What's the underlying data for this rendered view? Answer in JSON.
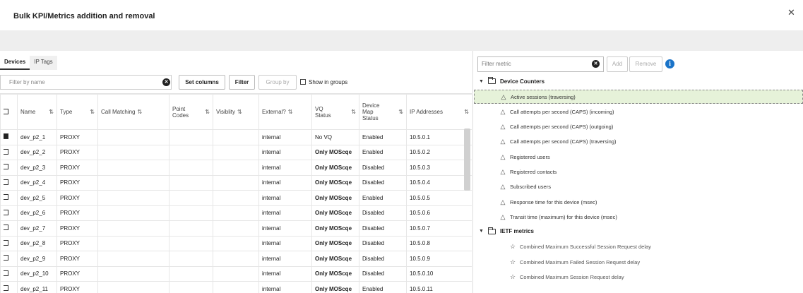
{
  "dialog": {
    "title": "Bulk KPI/Metrics addition and removal",
    "close_icon": "close-icon"
  },
  "tabs": [
    {
      "label": "Devices",
      "active": true
    },
    {
      "label": "IP Tags",
      "active": false
    }
  ],
  "toolbar": {
    "filter_placeholder": "Filter by name",
    "set_columns_label": "Set columns",
    "filter_label": "Filter",
    "group_by_label": "Group by",
    "show_in_groups_label": "Show in groups"
  },
  "table": {
    "headers": {
      "name": "Name",
      "type": "Type",
      "call_matching": "Call Matching",
      "point_codes": "Point Codes",
      "visibility": "Visiblity",
      "external": "External?",
      "vq_status": "VQ Status",
      "device_map_status": "Device Map Status",
      "ip_addresses": "IP Addresses"
    },
    "rows": [
      {
        "checked": true,
        "name": "dev_p2_1",
        "type": "PROXY",
        "external": "internal",
        "vq_status": "No VQ",
        "vq_bold": false,
        "map_status": "Enabled",
        "ip": "10.5.0.1"
      },
      {
        "checked": false,
        "name": "dev_p2_2",
        "type": "PROXY",
        "external": "internal",
        "vq_status": "Only MOScqe",
        "vq_bold": true,
        "map_status": "Enabled",
        "ip": "10.5.0.2"
      },
      {
        "checked": false,
        "name": "dev_p2_3",
        "type": "PROXY",
        "external": "internal",
        "vq_status": "Only MOScqe",
        "vq_bold": true,
        "map_status": "Disabled",
        "ip": "10.5.0.3"
      },
      {
        "checked": false,
        "name": "dev_p2_4",
        "type": "PROXY",
        "external": "internal",
        "vq_status": "Only MOScqe",
        "vq_bold": true,
        "map_status": "Disabled",
        "ip": "10.5.0.4"
      },
      {
        "checked": false,
        "name": "dev_p2_5",
        "type": "PROXY",
        "external": "internal",
        "vq_status": "Only MOScqe",
        "vq_bold": true,
        "map_status": "Enabled",
        "ip": "10.5.0.5"
      },
      {
        "checked": false,
        "name": "dev_p2_6",
        "type": "PROXY",
        "external": "internal",
        "vq_status": "Only MOScqe",
        "vq_bold": true,
        "map_status": "Disabled",
        "ip": "10.5.0.6"
      },
      {
        "checked": false,
        "name": "dev_p2_7",
        "type": "PROXY",
        "external": "internal",
        "vq_status": "Only MOScqe",
        "vq_bold": true,
        "map_status": "Disabled",
        "ip": "10.5.0.7"
      },
      {
        "checked": false,
        "name": "dev_p2_8",
        "type": "PROXY",
        "external": "internal",
        "vq_status": "Only MOScqe",
        "vq_bold": true,
        "map_status": "Disabled",
        "ip": "10.5.0.8"
      },
      {
        "checked": false,
        "name": "dev_p2_9",
        "type": "PROXY",
        "external": "internal",
        "vq_status": "Only MOScqe",
        "vq_bold": true,
        "map_status": "Disabled",
        "ip": "10.5.0.9"
      },
      {
        "checked": false,
        "name": "dev_p2_10",
        "type": "PROXY",
        "external": "internal",
        "vq_status": "Only MOScqe",
        "vq_bold": true,
        "map_status": "Disabled",
        "ip": "10.5.0.10"
      },
      {
        "checked": false,
        "name": "dev_p2_11",
        "type": "PROXY",
        "external": "internal",
        "vq_status": "Only MOScqe",
        "vq_bold": true,
        "map_status": "Enabled",
        "ip": "10.5.0.11"
      }
    ]
  },
  "metrics": {
    "filter_placeholder": "Filter metric",
    "add_label": "Add",
    "remove_label": "Remove",
    "groups": [
      {
        "label": "Device Counters",
        "icon": "folder-icon",
        "items": [
          {
            "label": "Active sessions (traversing)",
            "selected": true,
            "icon": "bell-icon"
          },
          {
            "label": "Call attempts per second (CAPS) (incoming)",
            "icon": "bell-icon"
          },
          {
            "label": "Call attempts per second (CAPS) (outgoing)",
            "icon": "bell-icon"
          },
          {
            "label": "Call attempts per second (CAPS) (traversing)",
            "icon": "bell-icon"
          },
          {
            "label": "Registered users",
            "icon": "bell-icon"
          },
          {
            "label": "Registered contacts",
            "icon": "bell-icon"
          },
          {
            "label": "Subscribed users",
            "icon": "bell-icon"
          },
          {
            "label": "Response time for this device (msec)",
            "icon": "bell-icon"
          },
          {
            "label": "Transit time (maximum) for this device (msec)",
            "icon": "bell-icon"
          }
        ]
      },
      {
        "label": "IETF metrics",
        "icon": "folder-icon",
        "items": [
          {
            "label": "Combined Maximum Successful Session Request delay",
            "icon": "star-icon"
          },
          {
            "label": "Combined Maximum Failed Session Request delay",
            "icon": "star-icon"
          },
          {
            "label": "Combined Maximum Session Request delay",
            "icon": "star-icon"
          }
        ]
      }
    ]
  }
}
